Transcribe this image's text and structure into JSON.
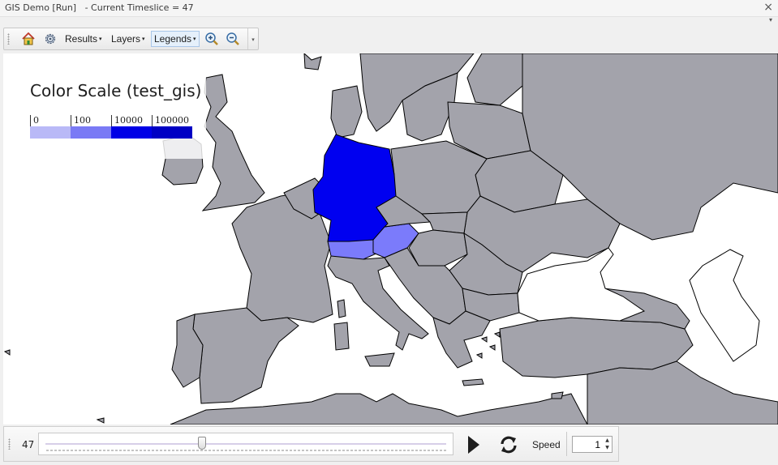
{
  "window": {
    "title": "GIS Demo [Run]   - Current Timeslice = 47",
    "close_glyph": "×",
    "menu_glyph": "▾"
  },
  "toolbar": {
    "home_icon": "home-icon",
    "settings_icon": "gear-icon",
    "results_label": "Results",
    "layers_label": "Layers",
    "legends_label": "Legends",
    "zoom_in_icon": "zoom-in-icon",
    "zoom_out_icon": "zoom-out-icon",
    "caret": "▾",
    "overflow_glyph": "▾"
  },
  "legend": {
    "title": "Color Scale (test_gis)",
    "ticks": [
      "0",
      "100",
      "10000",
      "100000"
    ],
    "colors": [
      "#b9b9f7",
      "#7a7af5",
      "#0000e6",
      "#0000c4"
    ]
  },
  "map": {
    "land_color": "#a3a3ab",
    "water_color": "#ffffff",
    "highlighted_regions": [
      {
        "name": "Germany",
        "color": "#0000f0"
      },
      {
        "name": "Austria",
        "color": "#7b7bfb"
      },
      {
        "name": "Switzerland",
        "color": "#7b7bfb"
      }
    ]
  },
  "timeline": {
    "timeslice": "47",
    "slider_value_fraction": 0.39,
    "speed_label": "Speed",
    "speed_value": "1",
    "spin_up": "▲",
    "spin_down": "▼"
  }
}
